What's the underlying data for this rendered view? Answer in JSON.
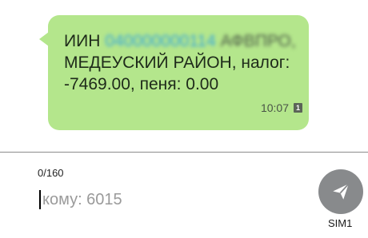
{
  "message": {
    "lines": [
      {
        "prefix": "ИИН ",
        "masked_a": "040000000114",
        "masked_b": " АФВПРО,"
      },
      {
        "text": "МЕДЕУСКИЙ РАЙОН, налог:"
      },
      {
        "text": "-7469.00, пеня: 0.00"
      }
    ],
    "time": "10:07",
    "sim_badge": "1",
    "bubble_color": "#b4e68c"
  },
  "composer": {
    "counter": "0/160",
    "placeholder": "кому: 6015",
    "value": "",
    "send_icon": "send-icon",
    "sim_label": "SIM1",
    "send_color": "#888a8c"
  }
}
